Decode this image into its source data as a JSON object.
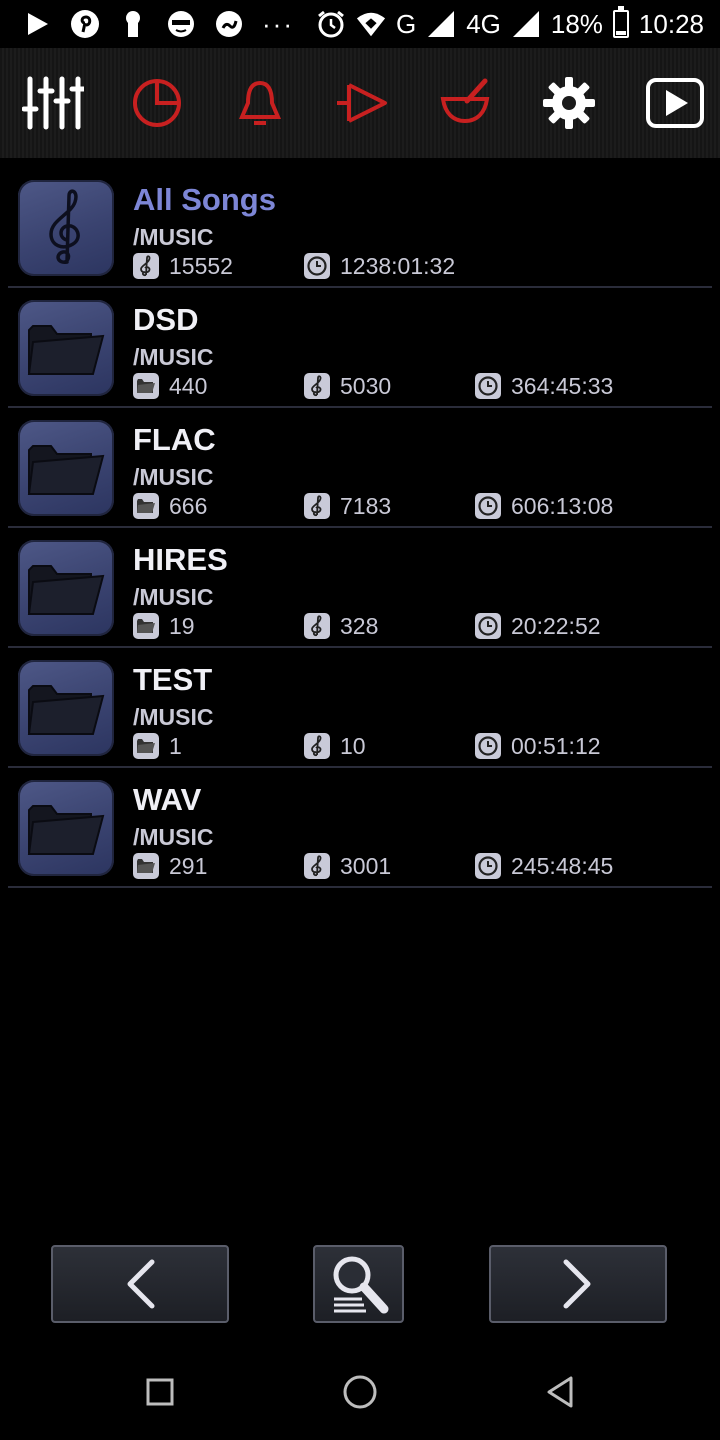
{
  "status_bar": {
    "icons": [
      "play-store-icon",
      "pinterest-icon",
      "keyhole-icon",
      "mask-icon",
      "snake-app-icon",
      "more-dots-icon",
      "alarm-icon",
      "wifi-icon",
      "signal-icon",
      "lte-signal-icon"
    ],
    "dots": "···",
    "network_g": "G",
    "network_4g": "4G",
    "battery": "18%",
    "battery_level": 0.18,
    "time": "10:28"
  },
  "toolbar": {
    "buttons": [
      {
        "icon": "equalizer-sliders-icon",
        "color": "#ffffff"
      },
      {
        "icon": "pie-chart-icon",
        "color": "#c82020"
      },
      {
        "icon": "bell-icon",
        "color": "#c82020"
      },
      {
        "icon": "forward-tag-icon",
        "color": "#c82020"
      },
      {
        "icon": "mortar-pestle-icon",
        "color": "#c82020"
      },
      {
        "icon": "gear-icon",
        "color": "#ffffff"
      },
      {
        "icon": "play-button-icon",
        "color": "#ffffff"
      }
    ]
  },
  "list": {
    "items": [
      {
        "title": "All Songs",
        "path": "/MUSIC",
        "songs": "15552",
        "duration": "1238:01:32"
      },
      {
        "title": "DSD",
        "path": "/MUSIC",
        "folders": "440",
        "songs": "5030",
        "duration": "364:45:33"
      },
      {
        "title": "FLAC",
        "path": "/MUSIC",
        "folders": "666",
        "songs": "7183",
        "duration": "606:13:08"
      },
      {
        "title": "HIRES",
        "path": "/MUSIC",
        "folders": "19",
        "songs": "328",
        "duration": "20:22:52"
      },
      {
        "title": "TEST",
        "path": "/MUSIC",
        "folders": "1",
        "songs": "10",
        "duration": "00:51:12"
      },
      {
        "title": "WAV",
        "path": "/MUSIC",
        "folders": "291",
        "songs": "3001",
        "duration": "245:48:45"
      }
    ]
  },
  "bottom_bar": {
    "prev_icon": "chevron-left-icon",
    "search_icon": "search-list-icon",
    "next_icon": "chevron-right-icon"
  },
  "nav_bar": {
    "recents_icon": "square-icon",
    "home_icon": "circle-icon",
    "back_icon": "triangle-back-icon"
  },
  "colors": {
    "accent": "#7d86d6",
    "toolbar_red": "#c82020",
    "thumb": "#3f4876"
  }
}
